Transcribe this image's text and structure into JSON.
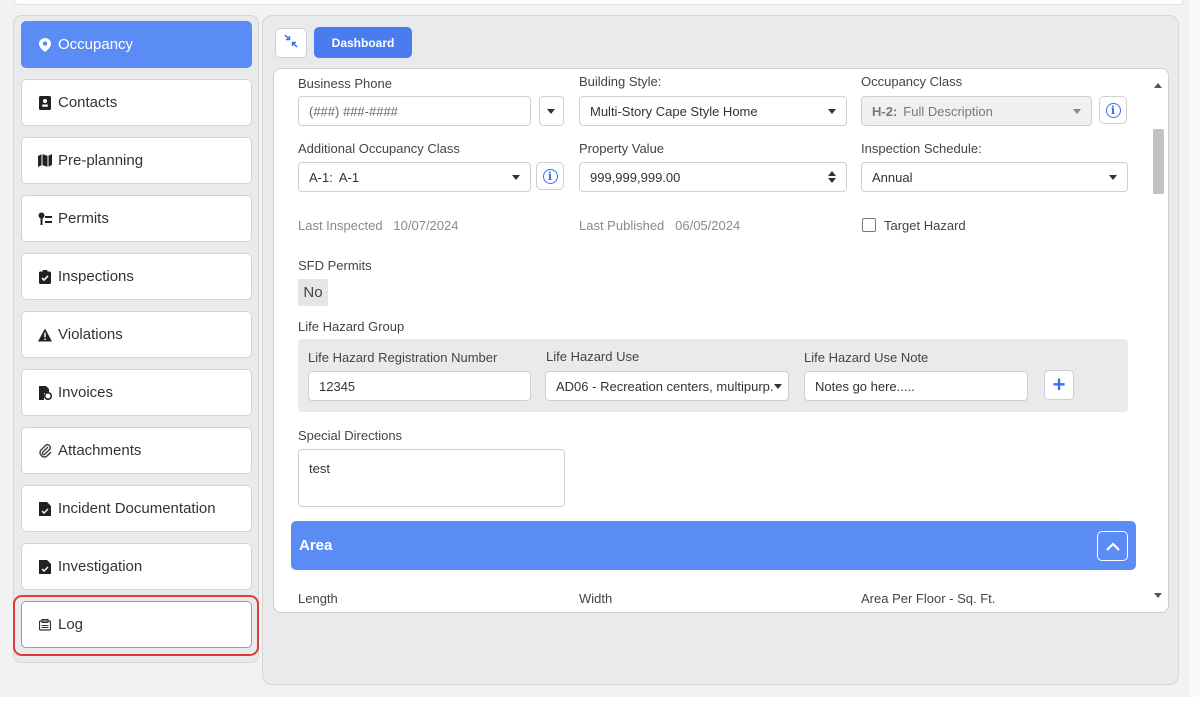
{
  "sidebar": {
    "items": [
      {
        "label": "Occupancy",
        "icon": "map-pin-icon",
        "active": true
      },
      {
        "label": "Contacts",
        "icon": "contact-card-icon"
      },
      {
        "label": "Pre-planning",
        "icon": "map-icon"
      },
      {
        "label": "Permits",
        "icon": "permit-icon"
      },
      {
        "label": "Inspections",
        "icon": "clipboard-check-icon"
      },
      {
        "label": "Violations",
        "icon": "warning-icon"
      },
      {
        "label": "Invoices",
        "icon": "invoice-icon"
      },
      {
        "label": "Attachments",
        "icon": "paperclip-icon"
      },
      {
        "label": "Incident Documentation",
        "icon": "document-icon"
      },
      {
        "label": "Investigation",
        "icon": "document-icon"
      },
      {
        "label": "Log",
        "icon": "log-icon"
      }
    ]
  },
  "toolbar": {
    "dashboard_label": "Dashboard"
  },
  "form": {
    "business_phone": {
      "label": "Business Phone",
      "placeholder": "(###) ###-####"
    },
    "building_style": {
      "label": "Building Style:",
      "value": "Multi-Story Cape Style Home"
    },
    "occupancy_class": {
      "label": "Occupancy Class",
      "code": "H-2:",
      "value": "Full Description"
    },
    "additional_occupancy_class": {
      "label": "Additional Occupancy Class",
      "code": "A-1:",
      "value": "A-1"
    },
    "property_value": {
      "label": "Property Value",
      "value": "999,999,999.00"
    },
    "inspection_schedule": {
      "label": "Inspection Schedule:",
      "value": "Annual"
    },
    "last_inspected": {
      "label": "Last Inspected",
      "value": "10/07/2024"
    },
    "last_published": {
      "label": "Last Published",
      "value": "06/05/2024"
    },
    "target_hazard": {
      "label": "Target Hazard"
    },
    "sfd_permits": {
      "label": "SFD Permits",
      "value": "No"
    },
    "life_hazard_group": {
      "label": "Life Hazard Group",
      "registration": {
        "label": "Life Hazard Registration Number",
        "value": "12345"
      },
      "use": {
        "label": "Life Hazard Use",
        "value": "AD06 - Recreation centers, multipurp..."
      },
      "note": {
        "label": "Life Hazard Use Note",
        "value": "Notes go here....."
      }
    },
    "special_directions": {
      "label": "Special Directions",
      "value": "test"
    }
  },
  "area": {
    "title": "Area",
    "length_label": "Length",
    "width_label": "Width",
    "area_per_floor_label": "Area Per Floor - Sq. Ft."
  },
  "colors": {
    "accent": "#5b8cf5",
    "button": "#4a7cf0",
    "highlight": "#e03b3b"
  }
}
